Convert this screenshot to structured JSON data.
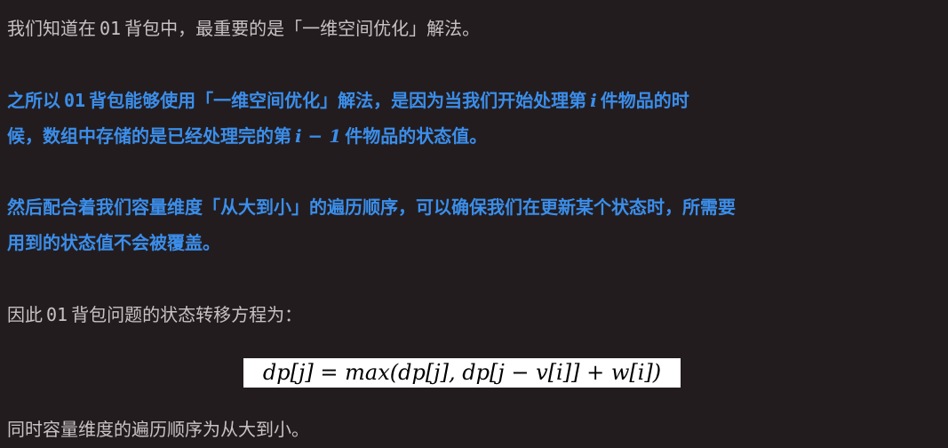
{
  "paragraph1": {
    "before": "我们知道在",
    "code": "01",
    "after": "背包中，最重要的是「一维空间优化」解法。"
  },
  "paragraph2": {
    "line1_before": "之所以",
    "line1_code": "01",
    "line1_mid": "背包能够使用「一维空间优化」解法，是因为当我们开始处理第",
    "line1_math": "i",
    "line1_after": "件物品的时",
    "line2_before": "候，数组中存储的是已经处理完的第",
    "line2_math": "i − 1",
    "line2_after": "件物品的状态值。"
  },
  "paragraph3": {
    "line1": "然后配合着我们容量维度「从大到小」的遍历顺序，可以确保我们在更新某个状态时，所需要",
    "line2": "用到的状态值不会被覆盖。"
  },
  "paragraph4": {
    "before": "因此",
    "code": "01",
    "after": "背包问题的状态转移方程为："
  },
  "formula": "dp[j] = max(dp[j], dp[j − v[i]] + w[i])",
  "paragraph5": "同时容量维度的遍历顺序为从大到小。"
}
